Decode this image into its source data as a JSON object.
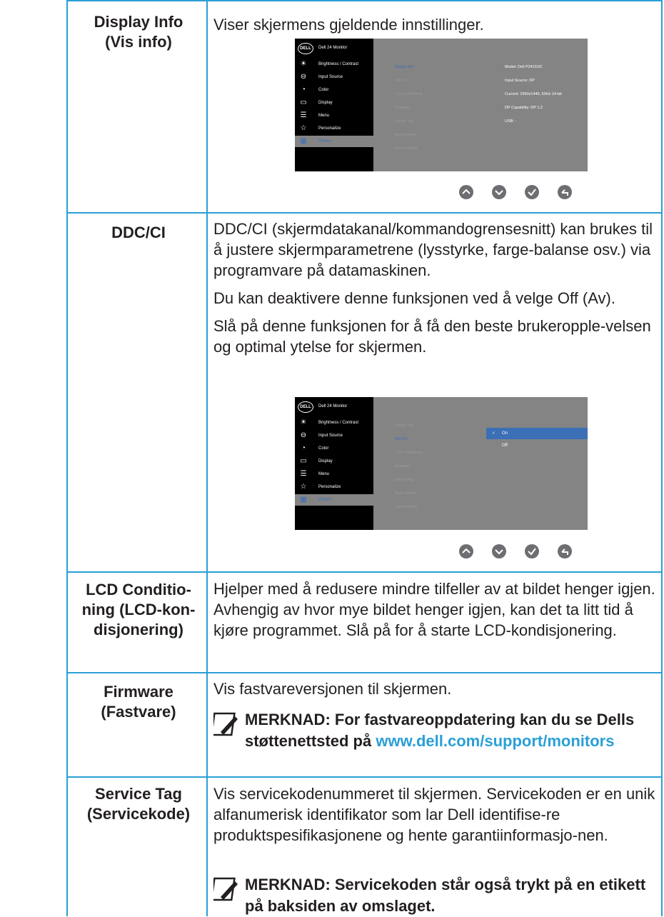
{
  "rows": {
    "display_info": {
      "label": "Display Info\n(Vis info)",
      "desc": "Viser skjermens gjeldende innstillinger."
    },
    "ddcci": {
      "label": "DDC/CI",
      "p1": "DDC/CI (skjermdatakanal/kommandogrensesnitt) kan brukes til å justere skjermparametrene (lysstyrke, farge-balanse osv.) via programvare på datamaskinen.",
      "p2": "Du kan deaktivere denne funksjonen ved å velge Off (Av).",
      "p3": "Slå på denne funksjonen for å få den beste brukeropple-velsen og optimal ytelse for skjermen."
    },
    "lcd": {
      "label": "LCD Conditio-ning (LCD-kon-disjonering)",
      "desc": "Hjelper med å redusere mindre tilfeller av at bildet henger igjen. Avhengig av hvor mye bildet henger igjen, kan det ta litt tid å kjøre programmet. Slå på for å starte LCD-kondisjonering."
    },
    "firmware": {
      "label": "Firmware (Fastvare)",
      "desc": "Vis fastvareversjonen til skjermen.",
      "note_prefix": "MERKNAD: For fastvareoppdatering kan du se Dells støttenettsted på ",
      "note_link": "www.dell.com/support/monitors"
    },
    "service_tag": {
      "label": "Service Tag (Servicekode)",
      "desc": "Vis servicekodenummeret til skjermen. Servicekoden er en unik alfanumerisk identifikator som lar Dell identifise-re produktspesifikasjonene og hente garantiinformasjo-nen.",
      "note": "MERKNAD: Servicekoden står også trykt på en etikett på baksiden av omslaget."
    }
  },
  "osd": {
    "logo": "DELL",
    "title": "Dell 24 Monitor",
    "menu": [
      {
        "label": "Brightness / Contrast",
        "icon": "brightness-icon"
      },
      {
        "label": "Input Source",
        "icon": "input-source-icon"
      },
      {
        "label": "Color",
        "icon": "color-icon"
      },
      {
        "label": "Display",
        "icon": "display-icon"
      },
      {
        "label": "Menu",
        "icon": "menu-icon"
      },
      {
        "label": "Personalize",
        "icon": "star-icon"
      },
      {
        "label": "Others",
        "icon": "others-icon"
      }
    ],
    "submenu": [
      "Display Info",
      "DDC/CI",
      "LCD Conditioning",
      "Firmware",
      "Service Tag",
      "Reset Others",
      "Factory Reset"
    ],
    "info": [
      "Model: Dell P2421DC",
      "Input Source: DP",
      "Current: 2560x1440, 60Hz 24-bit",
      "DP Capability: DP 1.2",
      "USB: -"
    ],
    "ddc_options": [
      "On",
      "Off"
    ],
    "accent": "#3b6fb6"
  },
  "colors": {
    "rule": "#2a9fd6",
    "link": "#2a9fd6"
  }
}
